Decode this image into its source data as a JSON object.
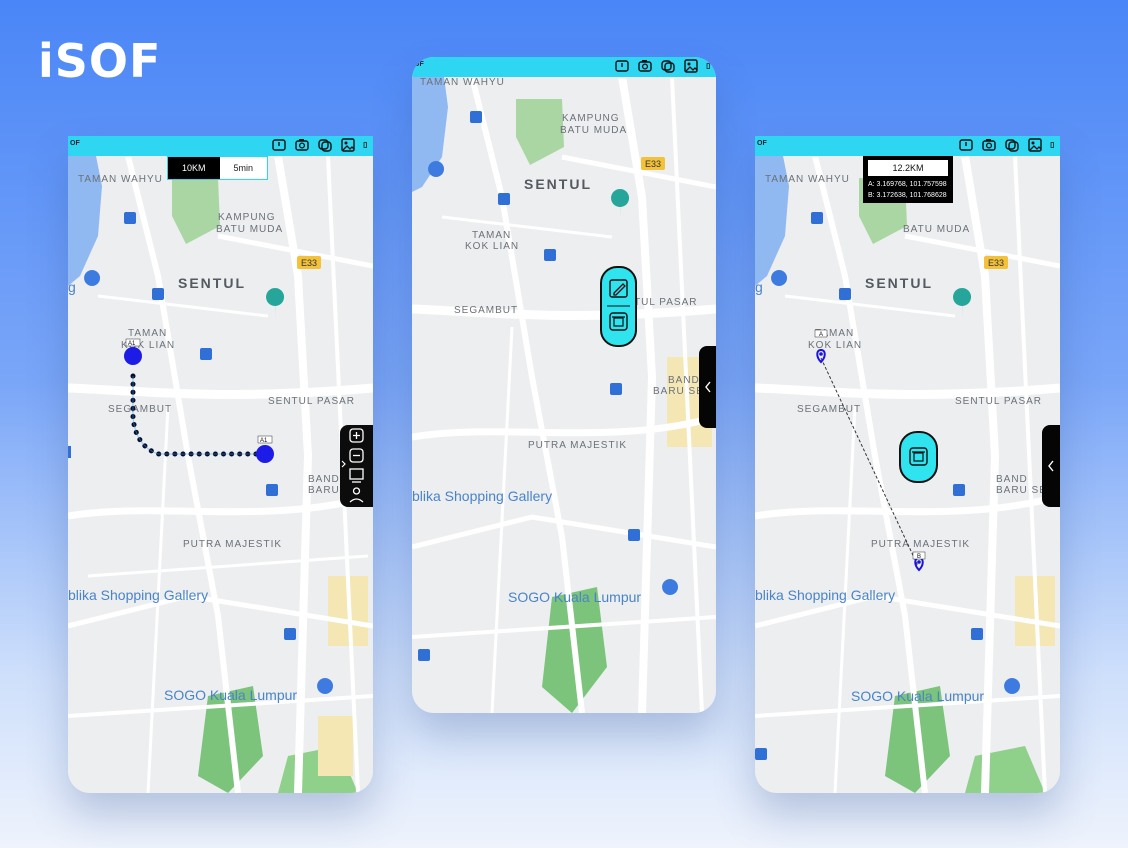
{
  "brand": "iSOF",
  "status_text": "OF",
  "status_icons": [
    "battery-icon",
    "camera-icon",
    "copy-icon",
    "image-icon",
    "menu-icon"
  ],
  "map": {
    "labels": {
      "taman_wahyu": "TAMAN WAHYU",
      "kampung_1": "KAMPUNG",
      "kampung_2": "BATU MUDA",
      "sentul": "SENTUL",
      "e33": "E33",
      "taman_kok_1": "TAMAN",
      "taman_kok_2": "KOK LIAN",
      "segambut": "SEGAMBUT",
      "sentul_pasar": "SENTUL PASAR",
      "sentul_pasar_partial": "TUL PASAR",
      "bandar_1": "BAND",
      "bandar_2": "BARU SE",
      "putra_majestik": "PUTRA MAJESTIK",
      "shopping_gallery": "blika Shopping Gallery",
      "sogo": "SOGO Kuala Lumpur",
      "g": "g"
    }
  },
  "screen1": {
    "distance_tab": "10KM",
    "time_tab": "5min",
    "marker_a": "A1",
    "marker_b": "A1",
    "tools": [
      "zoom-in-icon",
      "zoom-out-icon",
      "layers-icon",
      "location-pin-icon"
    ]
  },
  "screen2": {
    "actions": [
      "edit-icon",
      "delete-icon"
    ]
  },
  "screen3": {
    "distance": "12.2KM",
    "coord_a": "A: 3.169768, 101.757598",
    "coord_b": "B: 3.172638, 101.768628",
    "marker_a": "A",
    "marker_b": "B"
  },
  "colors": {
    "accent": "#2fd6f2",
    "route": "#0a0a2a",
    "marker": "#1a14e0",
    "park": "#7cc47c"
  }
}
